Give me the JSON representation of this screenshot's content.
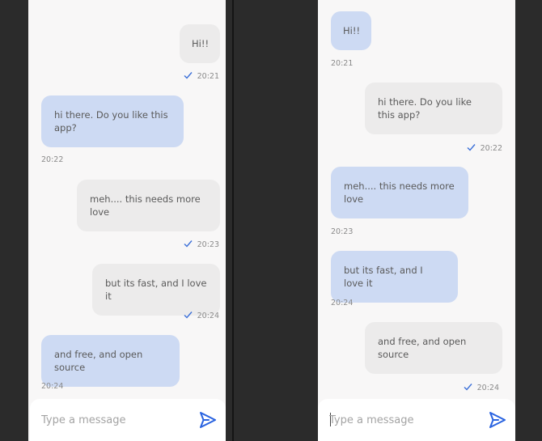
{
  "colors": {
    "backdrop": "#2b2b2b",
    "panel": "#f8f7f7",
    "received_bubble": "#cddaf3",
    "sent_bubble": "#ecebeb",
    "accent": "#2a63e0"
  },
  "left": {
    "messages": [
      {
        "text": "Hi!!",
        "time": "20:21",
        "direction": "sent"
      },
      {
        "text": "hi there. Do you like this app?",
        "time": "20:22",
        "direction": "received"
      },
      {
        "text": "meh.... this needs more love",
        "time": "20:23",
        "direction": "sent"
      },
      {
        "text": "but its fast, and I love it",
        "time": "20:24",
        "direction": "sent"
      },
      {
        "text": "and free, and open source",
        "time": "20:24",
        "direction": "received"
      }
    ],
    "composer": {
      "placeholder": "Type a message",
      "send_icon": "send-icon"
    }
  },
  "right": {
    "messages": [
      {
        "text": "Hi!!",
        "time": "20:21",
        "direction": "received"
      },
      {
        "text": "hi there. Do you like this app?",
        "time": "20:22",
        "direction": "sent"
      },
      {
        "text": "meh.... this needs more love",
        "time": "20:23",
        "direction": "received"
      },
      {
        "text": "but its fast, and I love it",
        "time": "20:24",
        "direction": "received"
      },
      {
        "text": "and free, and open source",
        "time": "20:24",
        "direction": "sent"
      }
    ],
    "composer": {
      "placeholder": "Type a message",
      "send_icon": "send-icon"
    }
  }
}
